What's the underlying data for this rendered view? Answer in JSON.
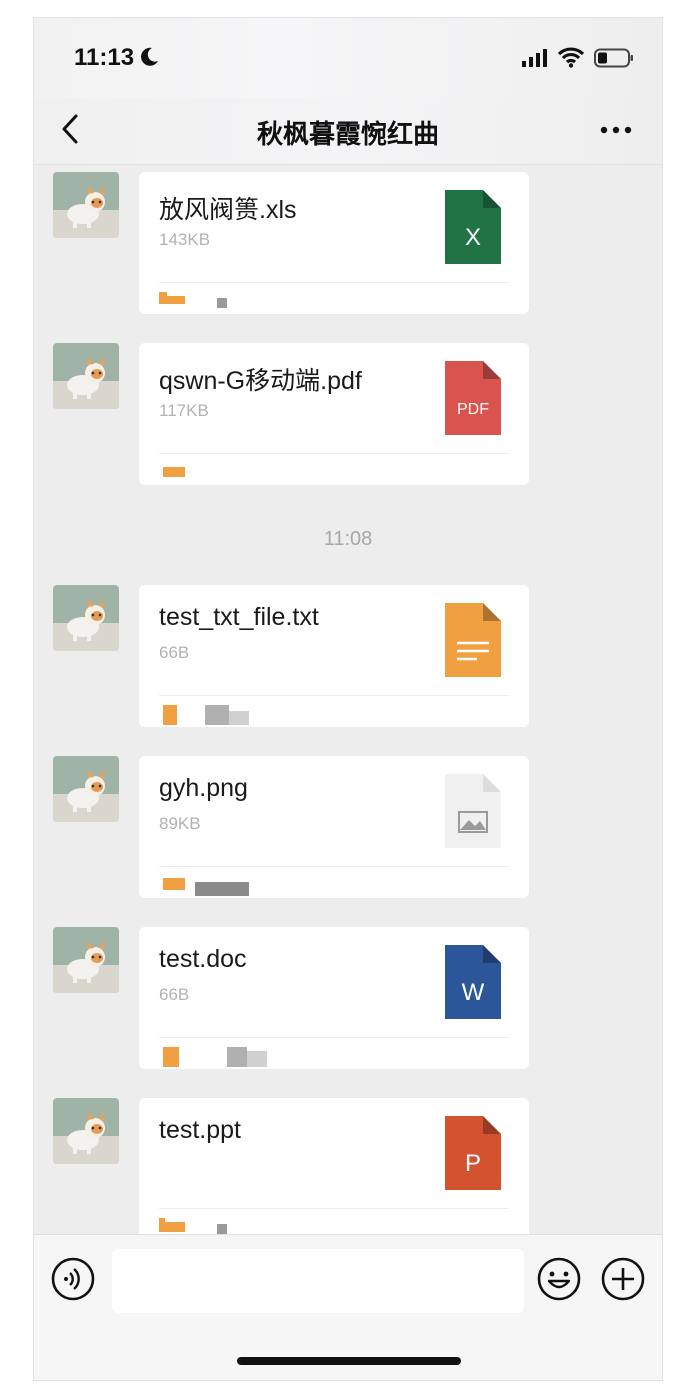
{
  "status_bar": {
    "time": "11:13"
  },
  "nav": {
    "title": "秋枫暮霞惋红曲"
  },
  "messages": [
    {
      "file_name": "放风阀篑.xls",
      "size": "143KB",
      "icon": "excel-file-icon",
      "icon_label": "X",
      "icon_color": "#217346"
    },
    {
      "file_name": "qswn-G移动端.pdf",
      "size": "117KB",
      "icon": "pdf-file-icon",
      "icon_label": "PDF",
      "icon_color": "#d9534f"
    },
    {
      "file_name": "test_txt_file.txt",
      "size": "66B",
      "icon": "text-file-icon",
      "icon_label": "",
      "icon_color": "#f0a040"
    },
    {
      "file_name": "gyh.png",
      "size": "89KB",
      "icon": "image-file-icon",
      "icon_label": "",
      "icon_color": "#f0f0f0"
    },
    {
      "file_name": "test.doc",
      "size": "66B",
      "icon": "word-file-icon",
      "icon_label": "W",
      "icon_color": "#2b579a"
    },
    {
      "file_name": "test.ppt",
      "size": "",
      "icon": "ppt-file-icon",
      "icon_label": "P",
      "icon_color": "#d35230"
    }
  ],
  "timestamp": "11:08",
  "input": {
    "placeholder": ""
  }
}
